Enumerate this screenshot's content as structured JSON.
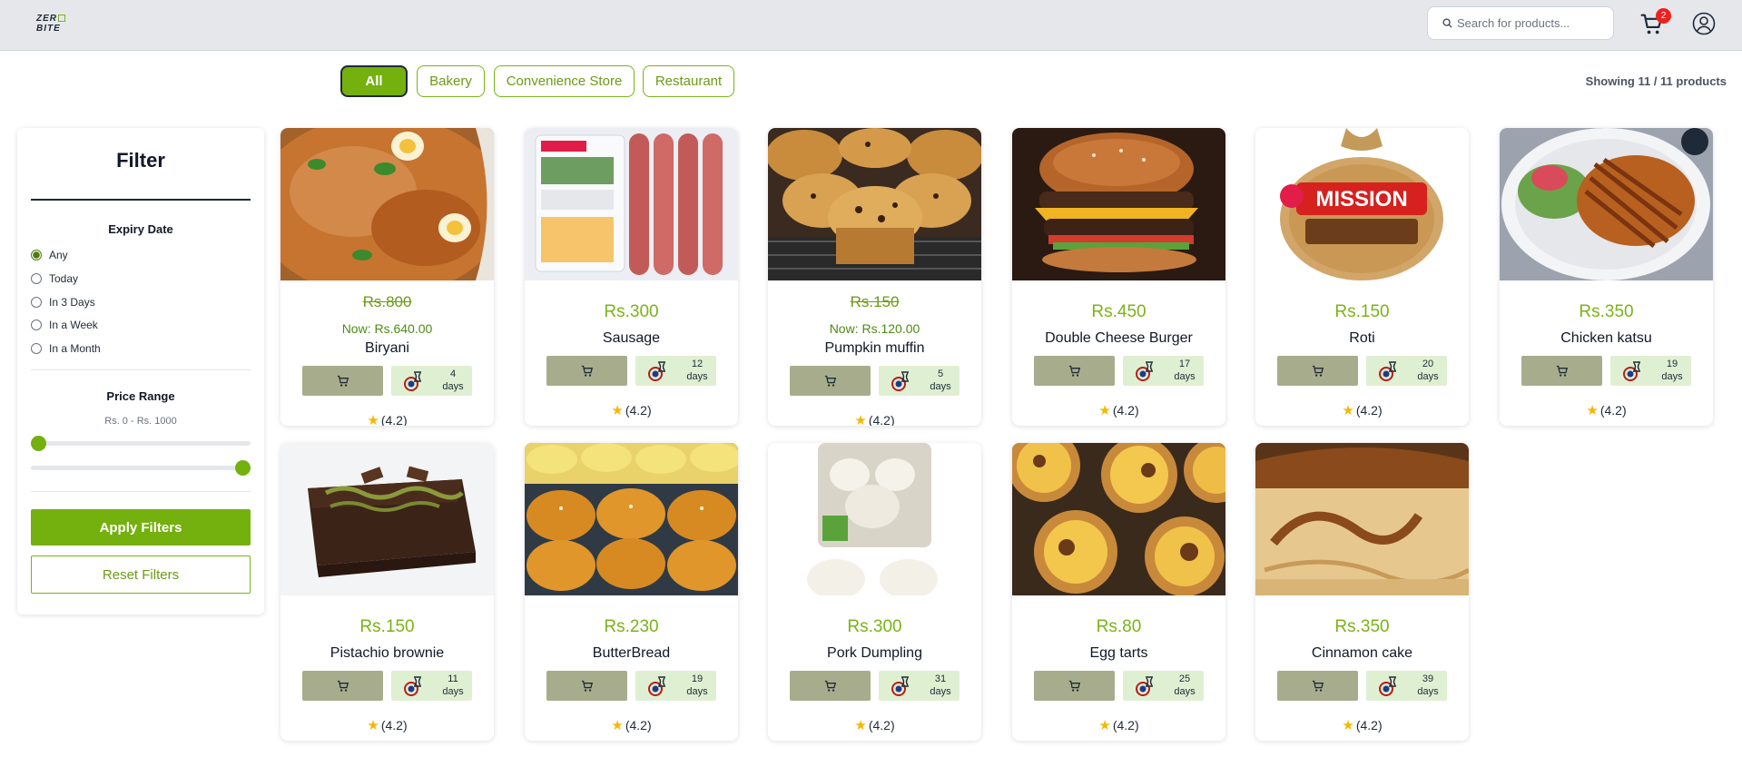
{
  "header": {
    "logo_line1": "ZER",
    "logo_line2": "BITE",
    "search_placeholder": "Search for products...",
    "cart_count": "2"
  },
  "tabs": [
    "All",
    "Bakery",
    "Convenience Store",
    "Restaurant"
  ],
  "product_count": "Showing 11 / 11 products",
  "filter": {
    "title": "Filter",
    "expiry_title": "Expiry Date",
    "expiry_options": [
      "Any",
      "Today",
      "In 3 Days",
      "In a Week",
      "In a Month"
    ],
    "selected_expiry": "Any",
    "price_title": "Price Range",
    "price_range_text": "Rs. 0 - Rs. 1000",
    "price_min": 0,
    "price_max": 1000,
    "apply_label": "Apply Filters",
    "reset_label": "Reset Filters"
  },
  "products": [
    {
      "name": "Biryani",
      "old_price": "Rs.800",
      "now_price": "Now: Rs.640.00",
      "expiry_days": "4",
      "rating": "(4.2)"
    },
    {
      "name": "Sausage",
      "price": "Rs.300",
      "expiry_days": "12",
      "rating": "(4.2)"
    },
    {
      "name": "Pumpkin muffin",
      "old_price": "Rs.150",
      "now_price": "Now: Rs.120.00",
      "expiry_days": "5",
      "rating": "(4.2)"
    },
    {
      "name": "Double Cheese Burger",
      "price": "Rs.450",
      "expiry_days": "17",
      "rating": "(4.2)"
    },
    {
      "name": "Roti",
      "price": "Rs.150",
      "expiry_days": "20",
      "rating": "(4.2)",
      "image_text": "MISSION"
    },
    {
      "name": "Chicken katsu",
      "price": "Rs.350",
      "expiry_days": "19",
      "rating": "(4.2)"
    },
    {
      "name": "Pistachio brownie",
      "price": "Rs.150",
      "expiry_days": "11",
      "rating": "(4.2)"
    },
    {
      "name": "ButterBread",
      "price": "Rs.230",
      "expiry_days": "19",
      "rating": "(4.2)"
    },
    {
      "name": "Pork Dumpling",
      "price": "Rs.300",
      "expiry_days": "31",
      "rating": "(4.2)"
    },
    {
      "name": "Egg tarts",
      "price": "Rs.80",
      "expiry_days": "25",
      "rating": "(4.2)"
    },
    {
      "name": "Cinnamon cake",
      "price": "Rs.350",
      "expiry_days": "39",
      "rating": "(4.2)"
    }
  ],
  "days_label": "days",
  "colors": {
    "accent": "#74b00e",
    "cart_button": "#a7ad8c",
    "expiry_bg": "#dff0d2",
    "badge": "#ef2020"
  }
}
